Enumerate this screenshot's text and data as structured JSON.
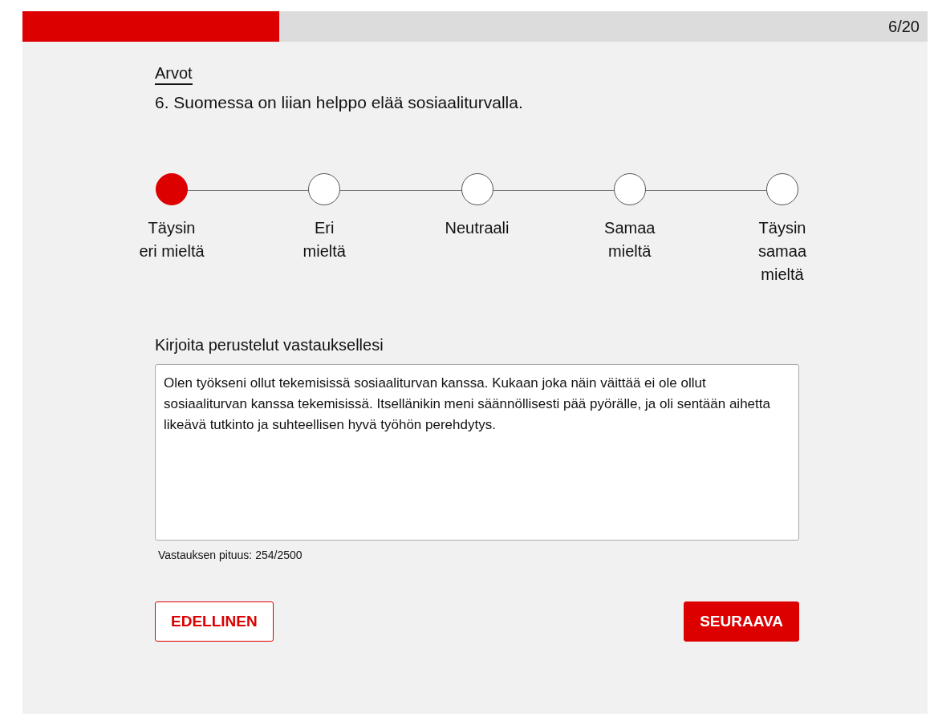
{
  "progress": {
    "level": 0.284,
    "counter": "6/20"
  },
  "category": "Arvot",
  "question": "6. Suomessa on liian helppo elää sosiaaliturvalla.",
  "options": [
    {
      "label": "Täysin eri mieltä",
      "selected": true
    },
    {
      "label": "Eri mieltä",
      "selected": false
    },
    {
      "label": "Neutraali",
      "selected": false
    },
    {
      "label": "Samaa mieltä",
      "selected": false
    },
    {
      "label": "Täysin samaa mieltä",
      "selected": false
    }
  ],
  "reason": {
    "label": "Kirjoita perustelut vastauksellesi",
    "value": "Olen työkseni ollut tekemisissä sosiaaliturvan kanssa. Kukaan joka näin väittää ei ole ollut sosiaaliturvan kanssa tekemisissä. Itsellänikin meni säännöllisesti pää pyörälle, ja oli sentään aihetta likeävä tutkinto ja suhteellisen hyvä työhön perehdytys.",
    "counter": "Vastauksen pituus: 254/2500"
  },
  "buttons": {
    "previous": "EDELLINEN",
    "next": "SEURAAVA"
  }
}
